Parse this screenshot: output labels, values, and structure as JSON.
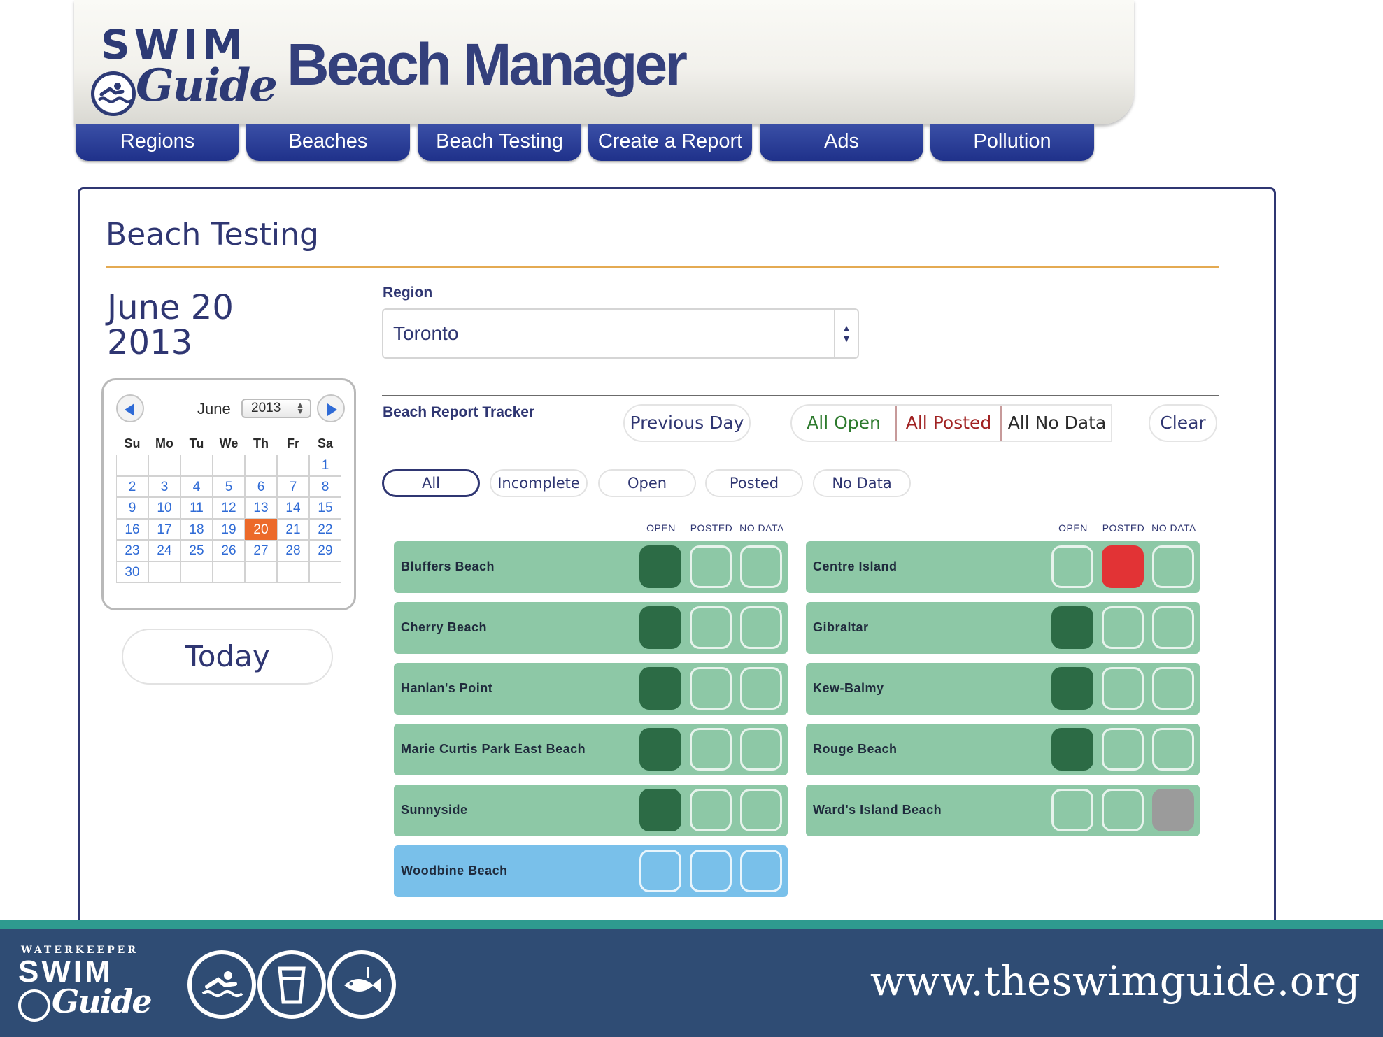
{
  "header": {
    "logo_swim": "SWIM",
    "logo_guide": "Guide",
    "app_title": "Beach Manager"
  },
  "nav": [
    {
      "label": "Regions"
    },
    {
      "label": "Beaches"
    },
    {
      "label": "Beach Testing"
    },
    {
      "label": "Create a Report"
    },
    {
      "label": "Ads"
    },
    {
      "label": "Pollution"
    }
  ],
  "page": {
    "title": "Beach Testing",
    "date_line1": "June 20",
    "date_line2": "2013"
  },
  "calendar": {
    "month": "June",
    "year": "2013",
    "weekdays": [
      "Su",
      "Mo",
      "Tu",
      "We",
      "Th",
      "Fr",
      "Sa"
    ],
    "first_weekday_index": 6,
    "days_in_month": 30,
    "selected_day": 20,
    "today_button": "Today"
  },
  "region": {
    "label": "Region",
    "selected": "Toronto"
  },
  "tracker": {
    "label": "Beach Report Tracker",
    "previous_day": "Previous Day",
    "all_open": "All Open",
    "all_posted": "All Posted",
    "all_no_data": "All No Data",
    "clear": "Clear"
  },
  "filters": [
    {
      "label": "All",
      "active": true
    },
    {
      "label": "Incomplete",
      "active": false
    },
    {
      "label": "Open",
      "active": false
    },
    {
      "label": "Posted",
      "active": false
    },
    {
      "label": "No Data",
      "active": false
    }
  ],
  "status_headers": [
    "OPEN",
    "POSTED",
    "NO DATA"
  ],
  "beaches_left": [
    {
      "name": "Bluffers Beach",
      "status": "open",
      "incomplete": false
    },
    {
      "name": "Cherry Beach",
      "status": "open",
      "incomplete": false
    },
    {
      "name": "Hanlan's Point",
      "status": "open",
      "incomplete": false
    },
    {
      "name": "Marie Curtis Park East Beach",
      "status": "open",
      "incomplete": false
    },
    {
      "name": "Sunnyside",
      "status": "open",
      "incomplete": false
    },
    {
      "name": "Woodbine Beach",
      "status": "none",
      "incomplete": true
    }
  ],
  "beaches_right": [
    {
      "name": "Centre Island",
      "status": "posted",
      "incomplete": false
    },
    {
      "name": "Gibraltar",
      "status": "open",
      "incomplete": false
    },
    {
      "name": "Kew-Balmy",
      "status": "open",
      "incomplete": false
    },
    {
      "name": "Rouge Beach",
      "status": "open",
      "incomplete": false
    },
    {
      "name": "Ward's Island Beach",
      "status": "nodata",
      "incomplete": false
    }
  ],
  "colors": {
    "open": "#2c6b45",
    "posted": "#e23335",
    "nodata": "#9b9b9b",
    "row_complete": "#8dc8a6",
    "row_incomplete": "#79c0ea",
    "calendar_selected": "#ec6a2a",
    "footer": "#2f4c74"
  },
  "footer": {
    "brand_top": "WATERKEEPER",
    "brand_swim": "SWIM",
    "brand_guide": "Guide",
    "icons": [
      "swimmer-icon",
      "drinking-glass-icon",
      "fish-icon"
    ],
    "url": "www.theswimguide.org"
  }
}
